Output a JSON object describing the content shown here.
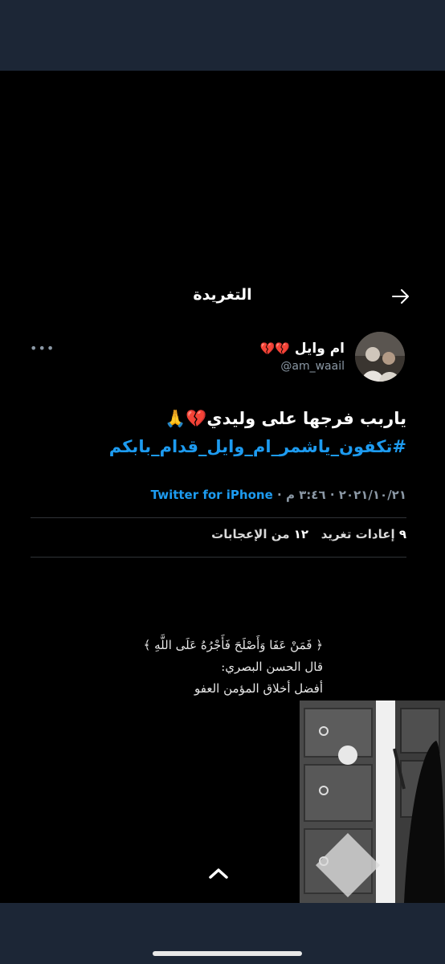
{
  "header": {
    "title": "التغريدة",
    "back_icon": "arrow-right-icon"
  },
  "tweet": {
    "author_name": "ام وايل",
    "author_emoji": "💔💔",
    "handle": "@am_waail",
    "more_icon": "more-options-icon",
    "text": "ياربب فرجها على وليدي💔🙏",
    "hashtag": "#تكفون_ياشمر_ام_وايل_قدام_بابكم",
    "date": "٢٠٢١/١٠/٢١",
    "time": "٣:٤٦ م",
    "separator": "·",
    "source": "Twitter for iPhone",
    "retweets_count": "٩",
    "retweets_label": "إعادات تغريد",
    "likes_count": "١٢",
    "likes_label": "من الإعجابات"
  },
  "overlay_quote": {
    "line1": "﴿ فَمَنْ عَفَا وَأَصْلَحَ فَأَجْرُهُ عَلَى اللَّهِ ﴾",
    "line2": "قال الحسن البصري:",
    "line3": "أفضل أخلاق المؤمن العفو"
  },
  "colors": {
    "background": "#000000",
    "band": "#1c2636",
    "link": "#1d9bf0",
    "secondary": "#8b98a5"
  }
}
